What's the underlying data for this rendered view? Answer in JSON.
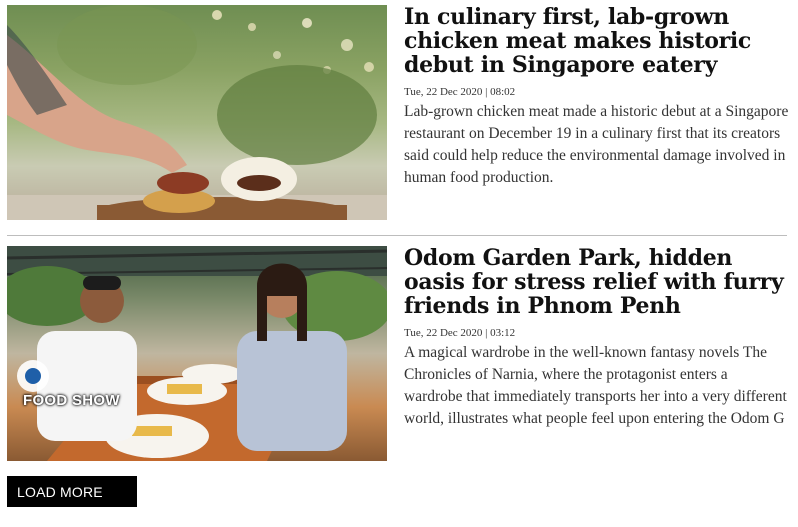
{
  "articles": [
    {
      "headline": "In culinary first, lab-grown chicken meat makes historic debut in Singapore eatery",
      "date": "Tue, 22 Dec 2020 | 08:02",
      "excerpt": "Lab-grown chicken meat made a historic debut at a Singapore restaurant on December 19 in a culinary first that its creators said could help reduce the environmental damage involved in human food production."
    },
    {
      "headline": "Odom Garden Park, hidden oasis for stress relief with furry friends in Phnom Penh",
      "date": "Tue, 22 Dec 2020 | 03:12",
      "excerpt": "A magical wardrobe in the well-known fantasy novels The Chronicles of Narnia, where the protagonist enters a wardrobe that immediately transports her into a very different world, illustrates what people feel upon entering the Odom G",
      "image_badge": "FOOD SHOW"
    }
  ],
  "load_more_label": "LOAD MORE"
}
